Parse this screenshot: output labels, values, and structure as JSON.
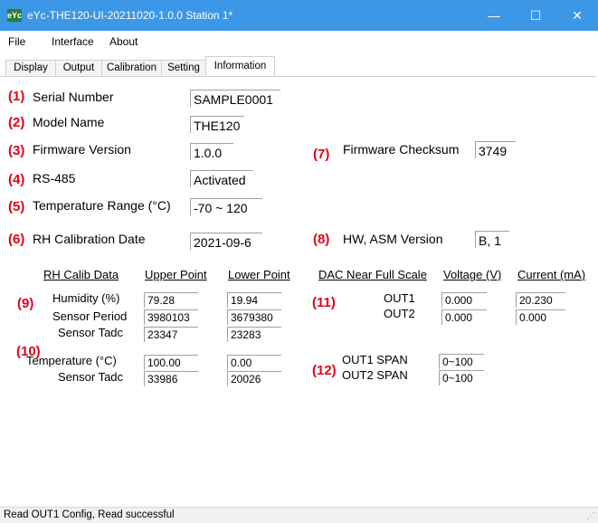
{
  "window": {
    "title": "eYc-THE120-UI-20211020-1.0.0  Station 1*",
    "icon_text": "eYc",
    "minimize_glyph": "—",
    "maximize_glyph": "☐",
    "close_glyph": "✕",
    "accent": "#3c97e6"
  },
  "menu": [
    "File",
    "Interface",
    "About"
  ],
  "tabs": [
    "Display",
    "Output",
    "Calibration",
    "Setting",
    "Information"
  ],
  "active_tab": "Information",
  "markers": [
    "(1)",
    "(2)",
    "(3)",
    "(4)",
    "(5)",
    "(6)",
    "(7)",
    "(8)",
    "(9)",
    "(10)",
    "(11)",
    "(12)"
  ],
  "marker_color": "#e0001a",
  "info": {
    "serial_label": "Serial Number",
    "serial_value": "SAMPLE0001",
    "model_label": "Model Name",
    "model_value": "THE120",
    "firmware_label": "Firmware Version",
    "firmware_value": "1.0.0",
    "checksum_label": "Firmware Checksum",
    "checksum_value": "3749",
    "rs485_label": "RS-485",
    "rs485_value": "Activated",
    "temp_range_label": "Temperature Range (°C)",
    "temp_range_value": "-70 ~ 120",
    "rh_date_label": "RH Calibration Date",
    "rh_date_value": "2021-09-6",
    "hw_label": "HW, ASM Version",
    "hw_value": "B, 1"
  },
  "rh_calib": {
    "header": "RH Calib Data",
    "upper": "Upper Point",
    "lower": "Lower Point",
    "rows": [
      {
        "label": "Humidity (%)",
        "upper": "79.28",
        "lower": "19.94"
      },
      {
        "label": "Sensor Period",
        "upper": "3980103",
        "lower": "3679380"
      },
      {
        "label": "Sensor Tadc",
        "upper": "23347",
        "lower": "23283"
      }
    ]
  },
  "temp_calib": {
    "rows": [
      {
        "label": "Temperature (°C)",
        "upper": "100.00",
        "lower": "0.00"
      },
      {
        "label": "Sensor Tadc",
        "upper": "33986",
        "lower": "20026"
      }
    ]
  },
  "dac": {
    "header": "DAC Near Full Scale",
    "voltage": "Voltage (V)",
    "current": "Current (mA)",
    "rows": [
      {
        "label": "OUT1",
        "voltage": "0.000",
        "current": "20.230"
      },
      {
        "label": "OUT2",
        "voltage": "0.000",
        "current": "0.000"
      }
    ]
  },
  "span": {
    "rows": [
      {
        "label": "OUT1 SPAN",
        "value": "0~100"
      },
      {
        "label": "OUT2 SPAN",
        "value": "0~100"
      }
    ]
  },
  "status": "Read OUT1 Config,   Read successful",
  "grip": "⋰"
}
